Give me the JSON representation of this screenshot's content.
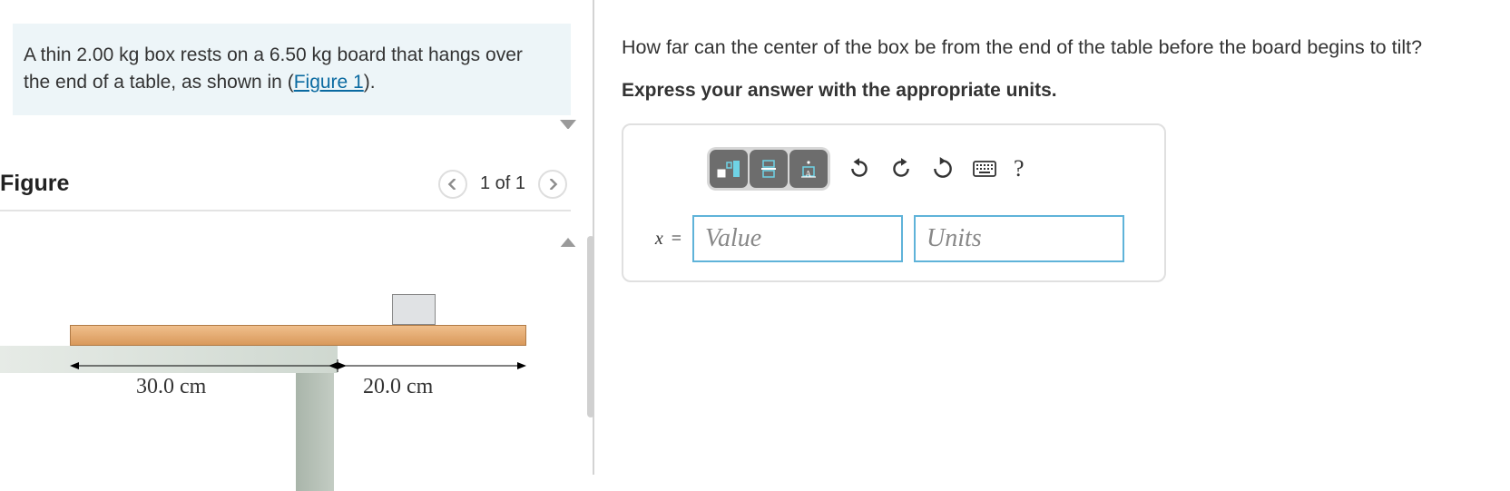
{
  "problem": {
    "text_before_link": "A thin 2.00 kg box rests on a 6.50 kg board that hangs over the end of a table, as shown in (",
    "link_text": "Figure 1",
    "text_after_link": ").",
    "box_mass_kg": 2.0,
    "board_mass_kg": 6.5
  },
  "figure": {
    "title": "Figure",
    "counter": "1 of 1",
    "dim_left": "30.0 cm",
    "dim_right": "20.0 cm"
  },
  "question": {
    "prompt": "How far can the center of the box be from the end of the table before the board begins to tilt?",
    "instruction": "Express your answer with the appropriate units."
  },
  "answer": {
    "variable": "x",
    "equals": "=",
    "value_placeholder": "Value",
    "units_placeholder": "Units"
  },
  "toolbar": {
    "help": "?"
  }
}
